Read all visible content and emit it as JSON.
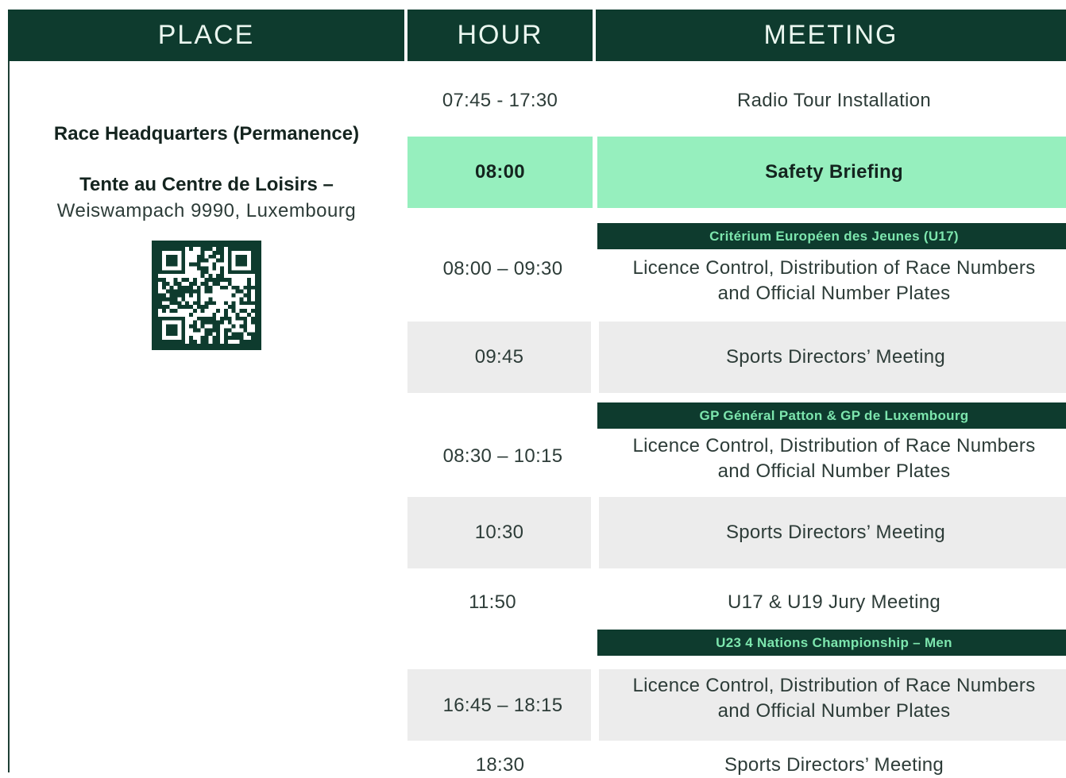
{
  "headers": {
    "place": "PLACE",
    "hour": "HOUR",
    "meeting": "MEETING"
  },
  "place": {
    "title": "Race Headquarters (Permanence)",
    "venue": "Tente au Centre de Loisirs –",
    "address": "Weiswampach 9990, Luxembourg",
    "qr_icon": "qr-code-icon"
  },
  "colors": {
    "header": "#0e3b2e",
    "header_text": "#eaf6ef",
    "highlight": "#96efbe",
    "subheader_text": "#7de6ae",
    "shaded": "#ececec"
  },
  "rows": [
    {
      "hour": "07:45 - 17:30",
      "meeting": "Radio Tour Installation"
    },
    {
      "hour": "08:00",
      "meeting": "Safety Briefing"
    },
    {
      "section": "Critérium Européen des Jeunes (U17)"
    },
    {
      "hour": "08:00 – 09:30",
      "meeting_line1": "Licence Control, Distribution of Race Numbers",
      "meeting_line2": "and Official Number Plates"
    },
    {
      "hour": "09:45",
      "meeting": "Sports Directors’ Meeting"
    },
    {
      "section": "GP Général Patton & GP de Luxembourg"
    },
    {
      "hour": "08:30 – 10:15",
      "meeting_line1": "Licence Control, Distribution of Race Numbers",
      "meeting_line2": "and Official Number Plates"
    },
    {
      "hour": "10:30",
      "meeting": "Sports Directors’ Meeting"
    },
    {
      "hour": "11:50",
      "meeting": "U17 & U19 Jury Meeting"
    },
    {
      "section": "U23 4 Nations Championship – Men"
    },
    {
      "hour": "16:45 – 18:15",
      "meeting_line1": "Licence Control, Distribution of Race Numbers",
      "meeting_line2": "and Official Number Plates"
    },
    {
      "hour": "18:30",
      "meeting": "Sports Directors’ Meeting"
    }
  ]
}
